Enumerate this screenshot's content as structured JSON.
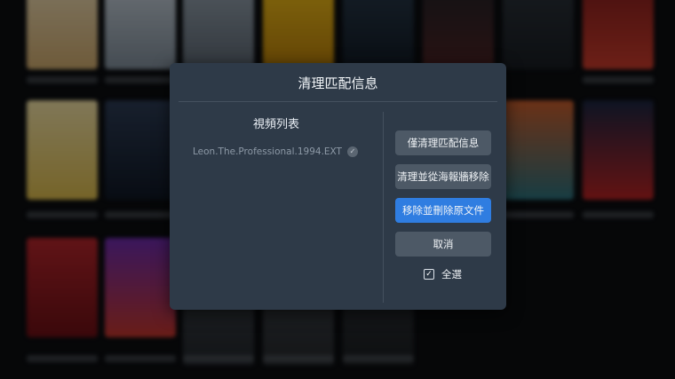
{
  "dialog": {
    "title": "清理匹配信息",
    "list_title": "視頻列表",
    "items": [
      {
        "name": "Leon.The.Professional.1994.EXTE..",
        "checked": true
      }
    ],
    "buttons": {
      "clear_match": "僅清理匹配信息",
      "clear_and_remove_wall": "清理並從海報牆移除",
      "remove_and_delete": "移除並刪除原文件",
      "cancel": "取消"
    },
    "select_all": {
      "label": "全選",
      "checked": true
    }
  },
  "colors": {
    "dialog_bg": "#2e3a48",
    "button_bg": "#4d5966",
    "primary_button_bg": "#2f7de1"
  },
  "icons": {
    "item_check": "check-circle-icon",
    "select_all": "checkbox-checked-icon"
  }
}
